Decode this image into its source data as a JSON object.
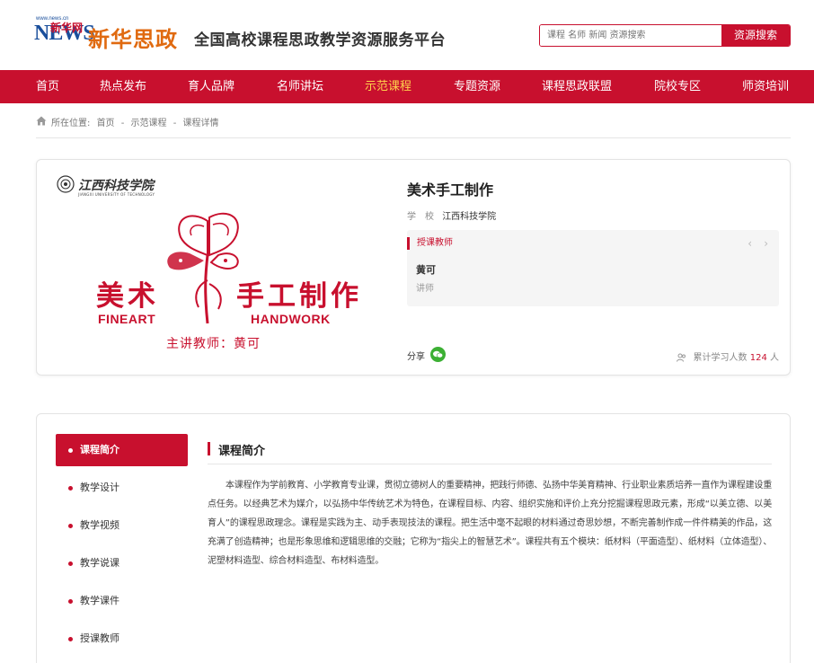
{
  "header": {
    "logo_news": "NEWS",
    "logo_news_cn": "新华网",
    "logo_brand": "新华思政",
    "site_title": "全国高校课程思政教学资源服务平台",
    "search_placeholder": "课程 名师 新闻 资源搜索",
    "search_button": "资源搜索"
  },
  "nav": {
    "items": [
      {
        "label": "首页"
      },
      {
        "label": "热点发布"
      },
      {
        "label": "育人品牌"
      },
      {
        "label": "名师讲坛"
      },
      {
        "label": "示范课程"
      },
      {
        "label": "专题资源"
      },
      {
        "label": "课程思政联盟"
      },
      {
        "label": "院校专区"
      },
      {
        "label": "师资培训"
      }
    ],
    "active_index": 4,
    "active_color": "#ffd24c"
  },
  "breadcrumb": {
    "prefix": "所在位置:",
    "items": [
      "首页",
      "-",
      "示范课程",
      "-",
      "课程详情"
    ]
  },
  "course": {
    "cover": {
      "school_name": "江西科技学院",
      "school_en": "JIANGXI UNIVERSITY OF TECHNOLOGY",
      "title_cn_left": "美术",
      "title_cn_right": "手工制作",
      "title_en_left": "FINEART",
      "title_en_right": "HANDWORK",
      "teacher_line": "主讲教师：黄可"
    },
    "title": "美术手工制作",
    "school_label": "学　校",
    "school_value": "江西科技学院",
    "teacher_section_label": "授课教师",
    "teacher_name": "黄可",
    "teacher_title": "讲师",
    "share_label": "分享",
    "learners_label": "累计学习人数",
    "learners_count": "124",
    "learners_unit": "人"
  },
  "sidebar": {
    "items": [
      {
        "label": "课程简介"
      },
      {
        "label": "教学设计"
      },
      {
        "label": "教学视频"
      },
      {
        "label": "教学说课"
      },
      {
        "label": "教学课件"
      },
      {
        "label": "授课教师"
      }
    ]
  },
  "intro": {
    "heading": "课程简介",
    "text": "本课程作为学前教育、小学教育专业课，贯彻立德树人的重要精神，把践行师德、弘扬中华美育精神、行业职业素质培养一直作为课程建设重点任务。以经典艺术为媒介，以弘扬中华传统艺术为特色，在课程目标、内容、组织实施和评价上充分挖掘课程思政元素，形成“以美立德、以美育人”的课程思政理念。课程是实践为主、动手表现技法的课程。把生活中毫不起眼的材料通过奇思妙想，不断完善制作成一件件精美的作品，这充满了创造精神；也是形象思维和逻辑思维的交融；它称为“指尖上的智慧艺术”。课程共有五个模块：纸材料（平面造型）、纸材料（立体造型）、泥塑材料造型、综合材料造型、布材料造型。"
  },
  "colors": {
    "brand_red": "#c8102e",
    "wechat_green": "#3cb034"
  }
}
